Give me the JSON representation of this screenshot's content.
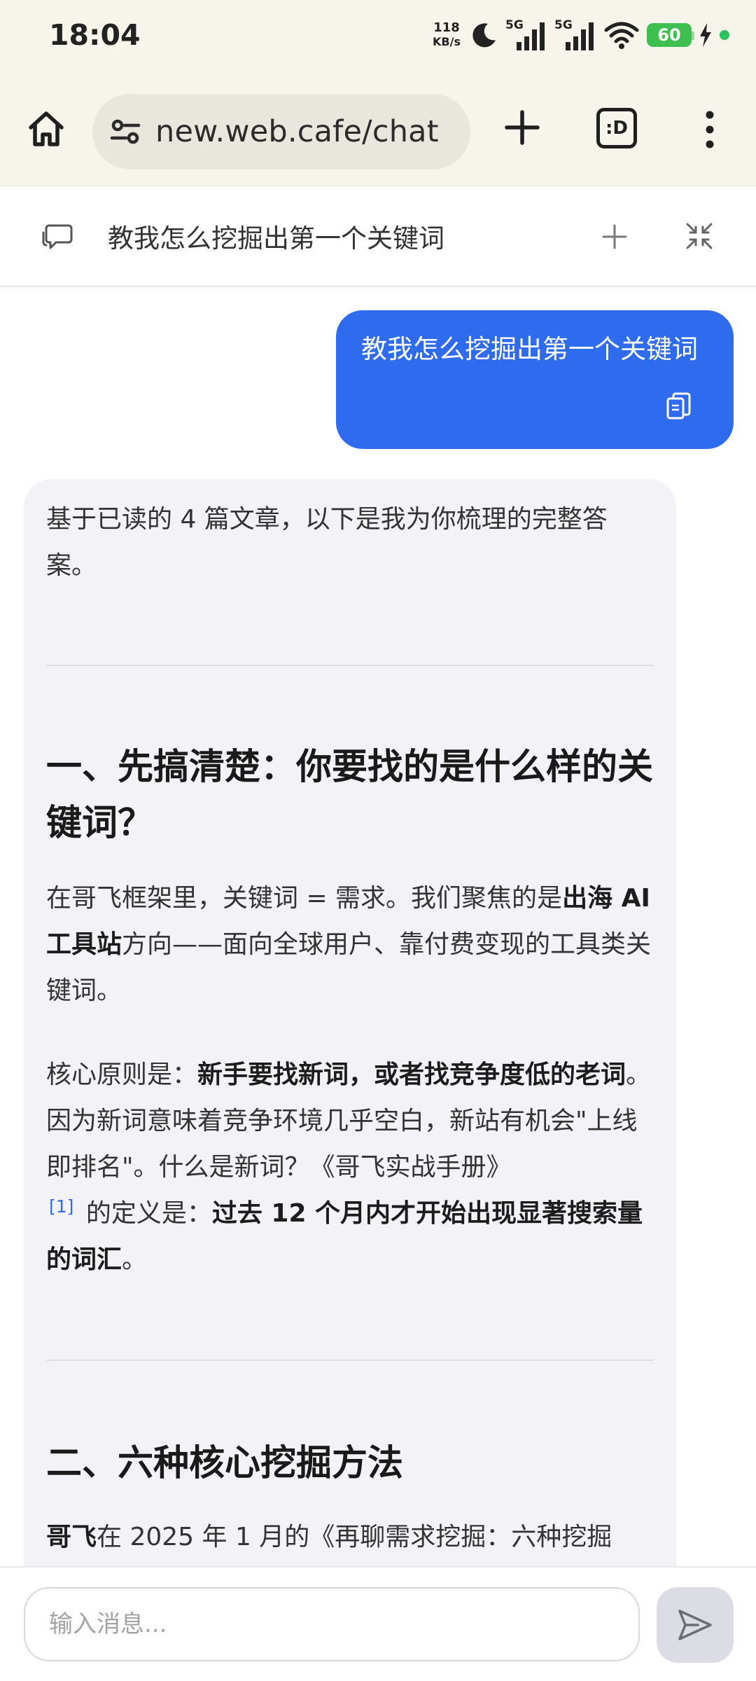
{
  "status_bar": {
    "time": "18:04",
    "net_speed_value": "118",
    "net_speed_unit": "KB/s",
    "sim1_label": "5G",
    "sim2_label": "5G",
    "battery_level": "60",
    "icons": [
      "moon-icon",
      "signal-5g-icon",
      "signal-5g-icon",
      "wifi-icon",
      "battery-icon",
      "charging-bolt-icon",
      "privacy-dot-icon"
    ]
  },
  "browser": {
    "url": "new.web.cafe/chat",
    "tab_count_label": ":D",
    "icons": [
      "home-icon",
      "site-settings-icon",
      "plus-icon",
      "tab-switcher-icon",
      "more-vert-icon"
    ]
  },
  "chat_header": {
    "title": "教我怎么挖掘出第一个关键词",
    "icons": [
      "chat-bubble-icon",
      "plus-icon",
      "collapse-icon"
    ]
  },
  "messages": {
    "user": {
      "text": "教我怎么挖掘出第一个关键词"
    },
    "ai": {
      "intro": "基于已读的 4 篇文章，以下是我为你梳理的完整答案。",
      "heading1": "一、先搞清楚：你要找的是什么样的关键词？",
      "p1_a": "在哥飞框架里，关键词 = 需求。我们聚焦的是",
      "p1_b": "出海 AI 工具站",
      "p1_c": "方向——面向全球用户、靠付费变现的工具类关键词。",
      "p2_a": "核心原则是：",
      "p2_b": "新手要找新词，或者找竞争度低的老词",
      "p2_c": "。因为新词意味着竞争环境几乎空白，新站有机会\"上线即排名\"。什么是新词？《哥飞实战手册》",
      "p2_cite": "[1]",
      "p2_d": " 的定义是：",
      "p2_e": "过去 12 个月内才开始出现显著搜索量的词汇",
      "p2_f": "。",
      "heading2": "二、六种核心挖掘方法",
      "p3_a": "哥飞",
      "p3_b": "在 2025 年 1 月的《再聊需求挖掘：六种挖掘"
    }
  },
  "composer": {
    "placeholder": "输入消息...",
    "value": ""
  }
}
